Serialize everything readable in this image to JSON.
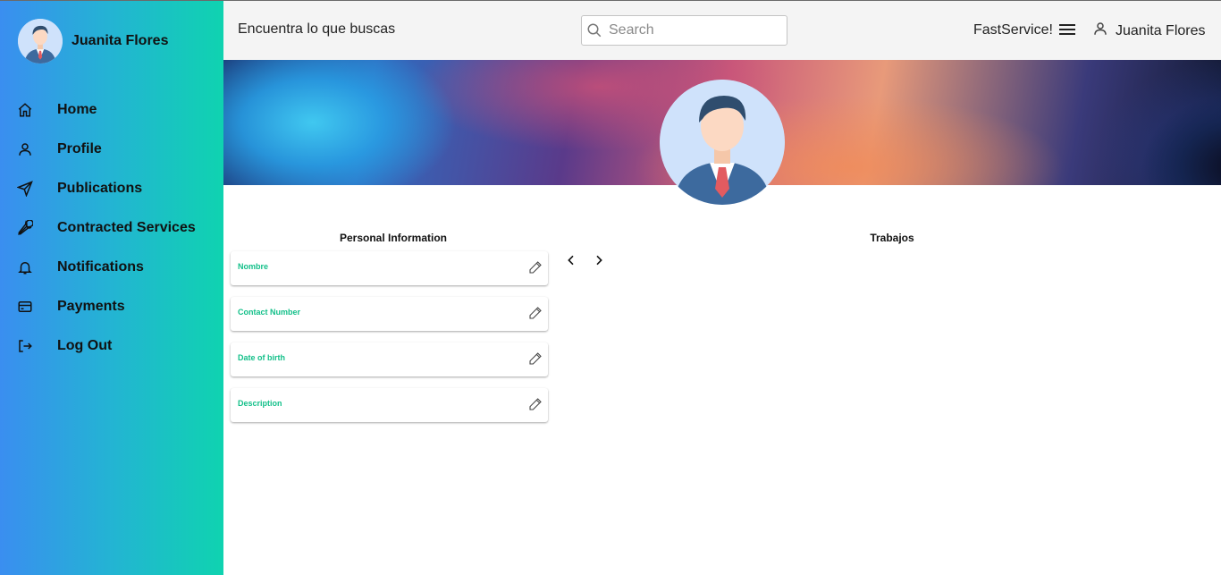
{
  "sidebar": {
    "user_name": "Juanita Flores",
    "items": [
      {
        "label": "Home",
        "icon": "home-icon"
      },
      {
        "label": "Profile",
        "icon": "user-icon"
      },
      {
        "label": "Publications",
        "icon": "send-icon"
      },
      {
        "label": "Contracted Services",
        "icon": "wrench-icon"
      },
      {
        "label": "Notifications",
        "icon": "bell-icon"
      },
      {
        "label": "Payments",
        "icon": "credit-card-icon"
      },
      {
        "label": "Log Out",
        "icon": "logout-icon"
      }
    ],
    "gradient_colors": [
      "#3a8ef0",
      "#0fd3b0"
    ]
  },
  "header": {
    "tagline": "Encuentra lo que buscas",
    "search_placeholder": "Search",
    "brand": "FastService!",
    "user_name": "Juanita Flores"
  },
  "personal_info": {
    "title": "Personal Information",
    "fields": [
      {
        "label": "Nombre"
      },
      {
        "label": "Contact Number"
      },
      {
        "label": "Date of birth"
      },
      {
        "label": "Description"
      }
    ],
    "label_color": "#14c08a"
  },
  "jobs": {
    "title": "Trabajos"
  }
}
